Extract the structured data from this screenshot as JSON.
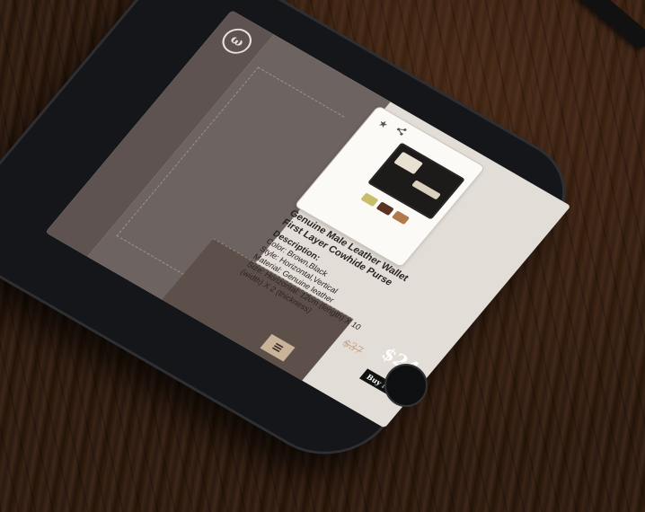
{
  "product": {
    "title_line1": "Genuine Male Leather Wallet",
    "title_line2": "First Layer Cowhide Purse",
    "description_heading": "Description:",
    "color": "Color: Brown,Black",
    "style": "Style: Horizontal,Vertical",
    "material": "Material: Genuine leather",
    "size": "Size: Horizontal: 12cm (length) X 10 (width) X 2 (thickness)",
    "old_price": "$37",
    "new_price": "$24",
    "buy_label": "Buy Now",
    "rating_icon": "★",
    "swatch_colors": [
      "#c7be6a",
      "#5a3423",
      "#b07a4a"
    ]
  },
  "logo_glyph": "ω",
  "menu_icon": "≡"
}
